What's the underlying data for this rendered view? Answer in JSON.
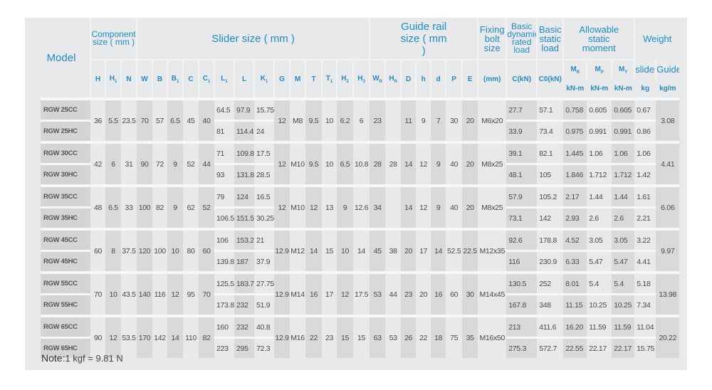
{
  "header": {
    "model": "Model",
    "component_size": "Component size ( mm )",
    "slider_size": "Slider size ( mm )",
    "guide_rail_size": "Guide rail size ( mm )",
    "fixing_bolt_size": "Fixing bolt size",
    "basic_dynamic": "Basic dynamic rated load",
    "basic_static": "Basic static load",
    "allowable_moment": "Allowable static moment",
    "weight": "Weight",
    "symbols": [
      "H",
      "H1",
      "N",
      "W",
      "B",
      "B1",
      "C",
      "C1",
      "L1",
      "L",
      "K1",
      "G",
      "M",
      "T",
      "T1",
      "H2",
      "H3",
      "WR",
      "HR",
      "D",
      "h",
      "d",
      "P",
      "E"
    ],
    "bolt_unit": "(mm)",
    "c_unit": "C(kN)",
    "c0_unit": "C0(kN)",
    "moments": [
      "MR",
      "MP",
      "MY"
    ],
    "moment_unit": "kN-m",
    "weight_cols": [
      "slider",
      "Guide"
    ],
    "weight_units": [
      "kg",
      "kg/m"
    ]
  },
  "groups": [
    {
      "shared": {
        "H": "36",
        "H1": "5.5",
        "N": "23.5",
        "W": "70",
        "B": "57",
        "B1": "6.5",
        "C": "45",
        "C1": "40",
        "G": "12",
        "M": "M8",
        "T": "9.5",
        "T1": "10",
        "H2": "6.2",
        "H3": "6",
        "WR": "23",
        "HR": "",
        "D": "11",
        "h": "9",
        "d": "7",
        "P": "30",
        "E": "20",
        "bolt": "M6x20",
        "guide": "3.08"
      },
      "rows": [
        {
          "model": "RGW 25CC",
          "L1": "64.5",
          "L": "97.9",
          "K1": "15.75",
          "Cd": "27.7",
          "C0": "57.1",
          "MR": "0.758",
          "MP": "0.605",
          "MY": "0.605",
          "slider": "0.67"
        },
        {
          "model": "RGW 25HC",
          "L1": "81",
          "L": "114.4",
          "K1": "24",
          "Cd": "33.9",
          "C0": "73.4",
          "MR": "0.975",
          "MP": "0.991",
          "MY": "0.991",
          "slider": "0.86"
        }
      ]
    },
    {
      "shared": {
        "H": "42",
        "H1": "6",
        "N": "31",
        "W": "90",
        "B": "72",
        "B1": "9",
        "C": "52",
        "C1": "44",
        "G": "12",
        "M": "M10",
        "T": "9.5",
        "T1": "10",
        "H2": "6.5",
        "H3": "10.8",
        "WR": "28",
        "HR": "28",
        "D": "14",
        "h": "12",
        "d": "9",
        "P": "40",
        "E": "20",
        "bolt": "M8x25",
        "guide": "4.41"
      },
      "rows": [
        {
          "model": "RGW 30CC",
          "L1": "71",
          "L": "109.8",
          "K1": "17.5",
          "Cd": "39.1",
          "C0": "82.1",
          "MR": "1.445",
          "MP": "1.06",
          "MY": "1.06",
          "slider": "1.06"
        },
        {
          "model": "RGW 30HC",
          "L1": "93",
          "L": "131.8",
          "K1": "28.5",
          "Cd": "48.1",
          "C0": "105",
          "MR": "1.846",
          "MP": "1.712",
          "MY": "1.712",
          "slider": "1.42"
        }
      ]
    },
    {
      "shared": {
        "H": "48",
        "H1": "6.5",
        "N": "33",
        "W": "100",
        "B": "82",
        "B1": "9",
        "C": "62",
        "C1": "52",
        "G": "12",
        "M": "M10",
        "T": "12",
        "T1": "13",
        "H2": "9",
        "H3": "12.6",
        "WR": "34",
        "HR": "",
        "D": "14",
        "h": "12",
        "d": "9",
        "P": "40",
        "E": "20",
        "bolt": "M8x25",
        "guide": "6.06"
      },
      "rows": [
        {
          "model": "RGW 35CC",
          "L1": "79",
          "L": "124",
          "K1": "16.5",
          "Cd": "57.9",
          "C0": "105.2",
          "MR": "2.17",
          "MP": "1.44",
          "MY": "1.44",
          "slider": "1.61"
        },
        {
          "model": "RGW 35HC",
          "L1": "106.5",
          "L": "151.5",
          "K1": "30.25",
          "Cd": "73.1",
          "C0": "142",
          "MR": "2.93",
          "MP": "2.6",
          "MY": "2.6",
          "slider": "2.21"
        }
      ]
    },
    {
      "shared": {
        "H": "60",
        "H1": "8",
        "N": "37.5",
        "W": "120",
        "B": "100",
        "B1": "10",
        "C": "80",
        "C1": "60",
        "G": "12.9",
        "M": "M12",
        "T": "14",
        "T1": "15",
        "H2": "10",
        "H3": "14",
        "WR": "45",
        "HR": "38",
        "D": "20",
        "h": "17",
        "d": "14",
        "P": "52.5",
        "E": "22.5",
        "bolt": "M12x35",
        "guide": "9.97"
      },
      "rows": [
        {
          "model": "RGW 45CC",
          "L1": "106",
          "L": "153.2",
          "K1": "21",
          "Cd": "92.6",
          "C0": "178.8",
          "MR": "4.52",
          "MP": "3.05",
          "MY": "3.05",
          "slider": "3.22"
        },
        {
          "model": "RGW 45HC",
          "L1": "139.8",
          "L": "187",
          "K1": "37.9",
          "Cd": "116",
          "C0": "230.9",
          "MR": "6.33",
          "MP": "5.47",
          "MY": "5.47",
          "slider": "4.41"
        }
      ]
    },
    {
      "shared": {
        "H": "70",
        "H1": "10",
        "N": "43.5",
        "W": "140",
        "B": "116",
        "B1": "12",
        "C": "95",
        "C1": "70",
        "G": "12.9",
        "M": "M14",
        "T": "16",
        "T1": "17",
        "H2": "12",
        "H3": "17.5",
        "WR": "53",
        "HR": "44",
        "D": "23",
        "h": "20",
        "d": "16",
        "P": "60",
        "E": "30",
        "bolt": "M14x45",
        "guide": "13.98"
      },
      "rows": [
        {
          "model": "RGW 55CC",
          "L1": "125.5",
          "L": "183.7",
          "K1": "27.75",
          "Cd": "130.5",
          "C0": "252",
          "MR": "8.01",
          "MP": "5.4",
          "MY": "5.4",
          "slider": "5.18"
        },
        {
          "model": "RGW 55HC",
          "L1": "173.8",
          "L": "232",
          "K1": "51.9",
          "Cd": "167.8",
          "C0": "348",
          "MR": "11.15",
          "MP": "10.25",
          "MY": "10.25",
          "slider": "7.34"
        }
      ]
    },
    {
      "shared": {
        "H": "90",
        "H1": "12",
        "N": "53.5",
        "W": "170",
        "B": "142",
        "B1": "14",
        "C": "110",
        "C1": "82",
        "G": "12.9",
        "M": "M16",
        "T": "22",
        "T1": "23",
        "H2": "15",
        "H3": "15",
        "WR": "63",
        "HR": "53",
        "D": "26",
        "h": "22",
        "d": "18",
        "P": "75",
        "E": "35",
        "bolt": "M16x50",
        "guide": "20.22"
      },
      "rows": [
        {
          "model": "RGW 65CC",
          "L1": "160",
          "L": "232",
          "K1": "40.8",
          "Cd": "213",
          "C0": "411.6",
          "MR": "16.20",
          "MP": "11.59",
          "MY": "11.59",
          "slider": "11.04"
        },
        {
          "model": "RGW 65HC",
          "L1": "223",
          "L": "295",
          "K1": "72.3",
          "Cd": "275.3",
          "C0": "572.7",
          "MR": "22.55",
          "MP": "22.17",
          "MY": "22.17",
          "slider": "15.75"
        }
      ]
    }
  ],
  "note": {
    "label": "Note:",
    "text": "1 kgf = 9.81 N"
  },
  "colors": {
    "header_text": "#1f8bc7",
    "panel": "#e8e9eb",
    "shaded_column": "#d8d9db"
  }
}
